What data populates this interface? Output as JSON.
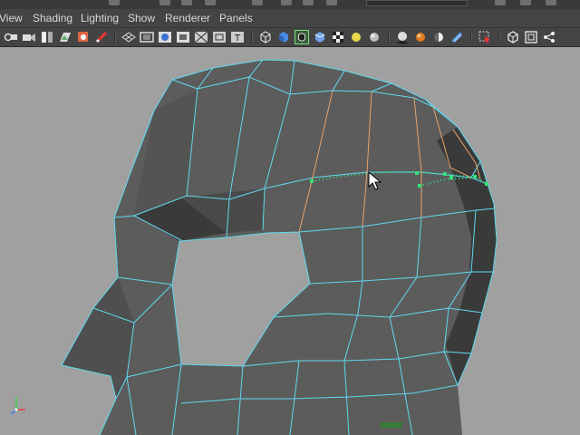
{
  "menubar": {
    "items": [
      {
        "id": "view",
        "label": "View"
      },
      {
        "id": "shading",
        "label": "Shading"
      },
      {
        "id": "lighting",
        "label": "Lighting"
      },
      {
        "id": "show",
        "label": "Show"
      },
      {
        "id": "renderer",
        "label": "Renderer"
      },
      {
        "id": "panels",
        "label": "Panels"
      }
    ]
  },
  "toolbar": {
    "icons": [
      "select-camera-icon",
      "camera-attributes-icon",
      "bookmarks-icon",
      "image-plane-icon",
      "grease-pencil-icon",
      "grid-icon",
      "film-gate-icon",
      "resolution-gate-icon",
      "gate-mask-icon",
      "field-chart-icon",
      "safe-title-icon",
      "wireframe-icon",
      "smooth-shade-icon",
      "wireframe-on-shaded-icon",
      "checker-texture-icon",
      "default-light-icon",
      "shadows-icon",
      "screen-space-ao-icon",
      "motion-blur-icon",
      "anti-aliasing-icon",
      "depth-of-field-icon",
      "isolate-select-icon",
      "xray-icon",
      "xray-joints-icon",
      "xray-components-icon"
    ]
  },
  "viewport": {
    "colors": {
      "background": "#a0a0a0",
      "mesh_fill": "#5c5c5c",
      "wire": "#5fd9f0",
      "edge_loop_highlight": "#e6a36a",
      "insert_loop_preview": "#33e07a"
    }
  },
  "gizmo": {
    "axes": [
      {
        "id": "x",
        "color": "#e53c3c"
      },
      {
        "id": "y",
        "color": "#3ccf4a"
      },
      {
        "id": "z",
        "color": "#3a7ef0"
      }
    ]
  }
}
